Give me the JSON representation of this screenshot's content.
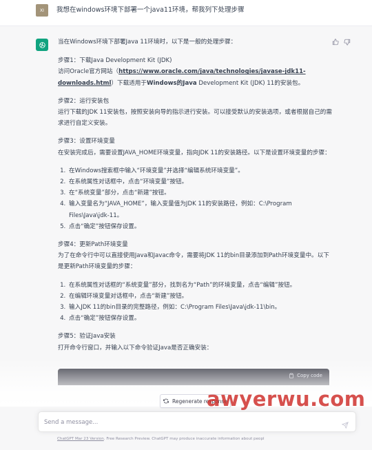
{
  "user": {
    "avatar_initials": "XI",
    "message": "我想在windows环境下部署一个java11环境，帮我列下处理步骤"
  },
  "assistant": {
    "intro": "当在Windows环境下部署Java 11环境时，以下是一般的处理步骤：",
    "step1": {
      "title": "步骤1：下载Java Development Kit (JDK)",
      "text_pre": "访问Oracle官方网站（",
      "link": "https://www.oracle.com/java/technologies/javase-jdk11-downloads.html",
      "text_mid": "）下载适用于",
      "bold": "Windows的Java",
      "text_post": " Development Kit (JDK) 11的安装包。"
    },
    "step2": {
      "title": "步骤2：运行安装包",
      "text": "运行下载的JDK 11安装包，按照安装向导的指示进行安装。可以接受默认的安装选项，或者根据自己的需求进行自定义安装。"
    },
    "step3": {
      "title": "步骤3：设置环境变量",
      "text": "在安装完成后，需要设置JAVA_HOME环境变量，指向JDK 11的安装路径。以下是设置环境变量的步骤：",
      "items": [
        "在Windows搜索框中输入“环境变量”并选择“编辑系统环境变量”。",
        "在系统属性对话框中，点击“环境变量”按钮。",
        "在“系统变量”部分，点击“新建”按钮。",
        "输入变量名为“JAVA_HOME”，输入变量值为JDK 11的安装路径，例如：C:\\Program Files\\Java\\jdk-11。",
        "点击“确定”按钮保存设置。"
      ]
    },
    "step4": {
      "title": "步骤4：更新Path环境变量",
      "text": "为了在命令行中可以直接使用Java和Javac命令，需要将JDK 11的bin目录添加到Path环境变量中。以下是更新Path环境变量的步骤：",
      "items": [
        "在系统属性对话框的“系统变量”部分，找到名为“Path”的环境变量，点击“编辑”按钮。",
        "在编辑环境变量对话框中，点击“新建”按钮。",
        "输入JDK 11的bin目录的完整路径，例如：C:\\Program Files\\Java\\jdk-11\\bin。",
        "点击“确定”按钮保存设置。"
      ]
    },
    "step5": {
      "title": "步骤5：验证Java安装",
      "text": "打开命令行窗口，并输入以下命令验证Java是否正确安装："
    },
    "copy_code_label": "Copy code"
  },
  "controls": {
    "regenerate_label": "Regenerate response",
    "input_placeholder": "Send a message..."
  },
  "footer": {
    "version_link": "ChatGPT Mar 23 Version",
    "note": ". Free Research Preview. ChatGPT may produce inaccurate information about peopl"
  },
  "watermark": "awyerwu.com",
  "colors": {
    "brand_green": "#10a37f",
    "assistant_bg": "#f7f7f8",
    "code_bg": "#343541",
    "watermark": "#cd2a26"
  }
}
